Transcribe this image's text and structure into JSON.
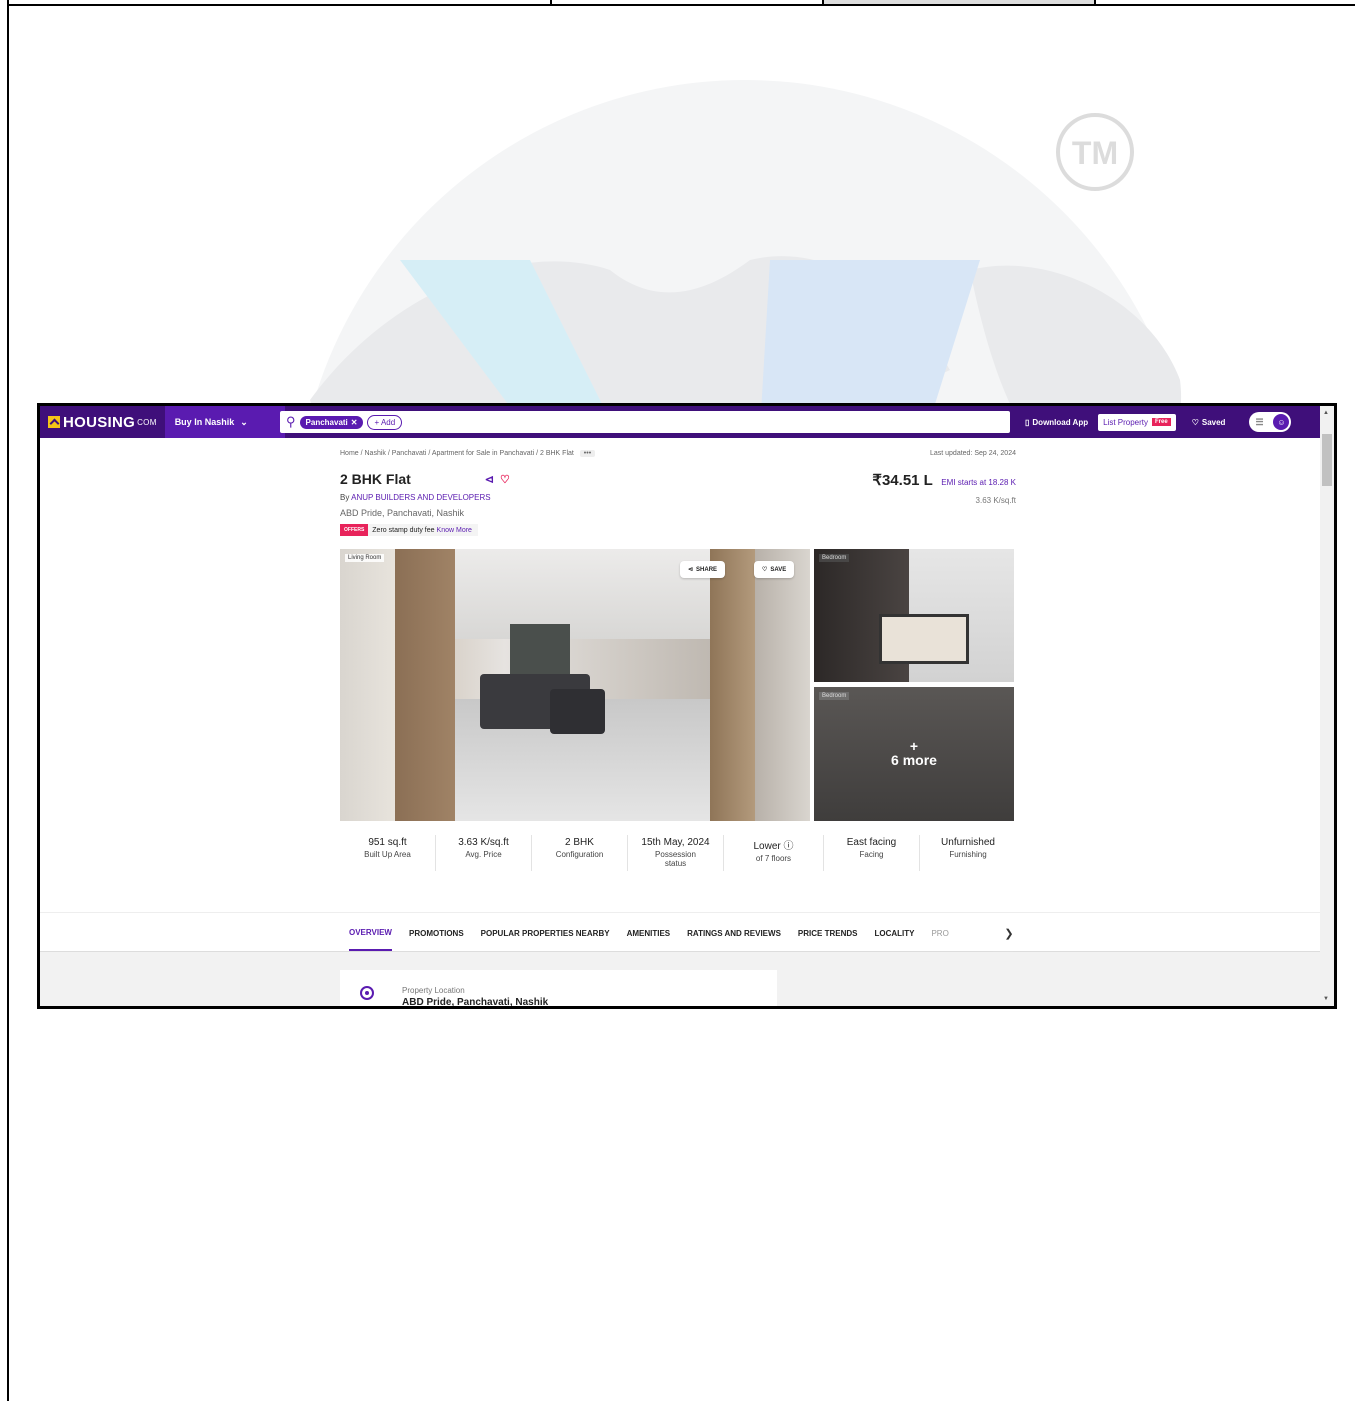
{
  "watermark": {
    "badge": "TM"
  },
  "navbar": {
    "logo": "HOUSING",
    "logo_suffix": "COM",
    "buy_in": "Buy In Nashik",
    "search_chip": "Panchavati",
    "add_chip": "+ Add",
    "download_app": "Download App",
    "list_property": "List Property",
    "free_badge": "Free",
    "saved": "Saved"
  },
  "breadcrumb": {
    "path": "Home / Nashik / Panchavati / Apartment for Sale in Panchavati / 2 BHK Flat",
    "more": "•••",
    "last_updated": "Last updated: Sep 24, 2024"
  },
  "listing": {
    "title": "2 BHK Flat",
    "price": "₹34.51 L",
    "emi": "EMI starts at  18.28 K",
    "price_per_sqft": "3.63 K/sq.ft",
    "by_prefix": "By",
    "builder": "ANUP BUILDERS AND DEVELOPERS",
    "location": "ABD Pride, Panchavati, Nashik",
    "offer_tag": "OFFERS",
    "offer_text": "Zero stamp duty fee",
    "offer_link": "Know More"
  },
  "gallery": {
    "main_label": "Living Room",
    "share": "SHARE",
    "save": "SAVE",
    "side1_label": "Bedroom",
    "side2_label": "Bedroom",
    "more_plus": "+",
    "more_text": "6 more"
  },
  "stats": [
    {
      "value": "951 sq.ft",
      "label": "Built Up Area"
    },
    {
      "value": "3.63 K/sq.ft",
      "label": "Avg. Price"
    },
    {
      "value": "2 BHK",
      "label": "Configuration"
    },
    {
      "value": "15th May, 2024",
      "label": "Possession status"
    },
    {
      "value": "Lower",
      "label": "of 7 floors"
    },
    {
      "value": "East facing",
      "label": "Facing"
    },
    {
      "value": "Unfurnished",
      "label": "Furnishing"
    }
  ],
  "tabs": [
    "OVERVIEW",
    "PROMOTIONS",
    "POPULAR PROPERTIES NEARBY",
    "AMENITIES",
    "RATINGS AND REVIEWS",
    "PRICE TRENDS",
    "LOCALITY",
    "PRO"
  ],
  "location_card": {
    "label": "Property Location",
    "value": "ABD Pride, Panchavati, Nashik"
  },
  "colors": {
    "brand": "#3f0f7a",
    "accent": "#5a1bb0",
    "offer": "#e8235b"
  }
}
